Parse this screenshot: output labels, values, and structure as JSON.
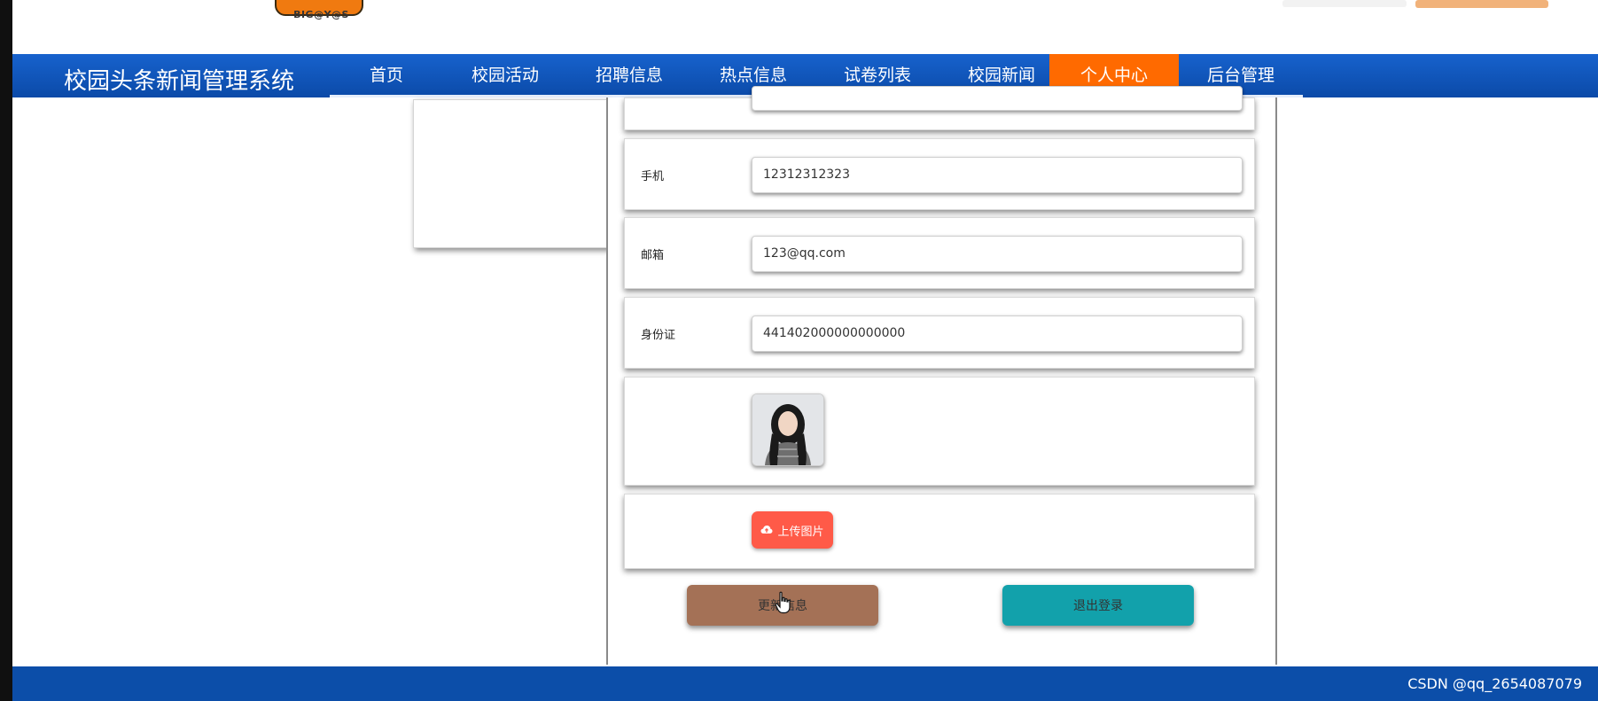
{
  "header": {
    "logo_subtext": "-BIG@Y@S-"
  },
  "navbar": {
    "brand": "校园头条新闻管理系统",
    "items": [
      {
        "label": "首页",
        "active": false
      },
      {
        "label": "校园活动",
        "active": false
      },
      {
        "label": "招聘信息",
        "active": false
      },
      {
        "label": "热点信息",
        "active": false
      },
      {
        "label": "试卷列表",
        "active": false
      },
      {
        "label": "校园新闻",
        "active": false
      },
      {
        "label": "个人中心",
        "active": true
      },
      {
        "label": "后台管理",
        "active": false
      }
    ],
    "active_color": "#ff6a00",
    "bar_color": "#0f57bd"
  },
  "form": {
    "phone_label": "手机",
    "phone_value": "12312312323",
    "email_label": "邮箱",
    "email_value": "123@qq.com",
    "id_label": "身份证",
    "id_value": "441402000000000000",
    "upload_label": "上传图片"
  },
  "actions": {
    "update_label": "更新信息",
    "logout_label": "退出登录",
    "update_color": "#a47156",
    "logout_color": "#12a1ab"
  },
  "footer": {
    "watermark": "CSDN @qq_2654087079"
  },
  "icons": {
    "upload": "cloud-upload-icon",
    "cursor": "hand-cursor-icon"
  }
}
